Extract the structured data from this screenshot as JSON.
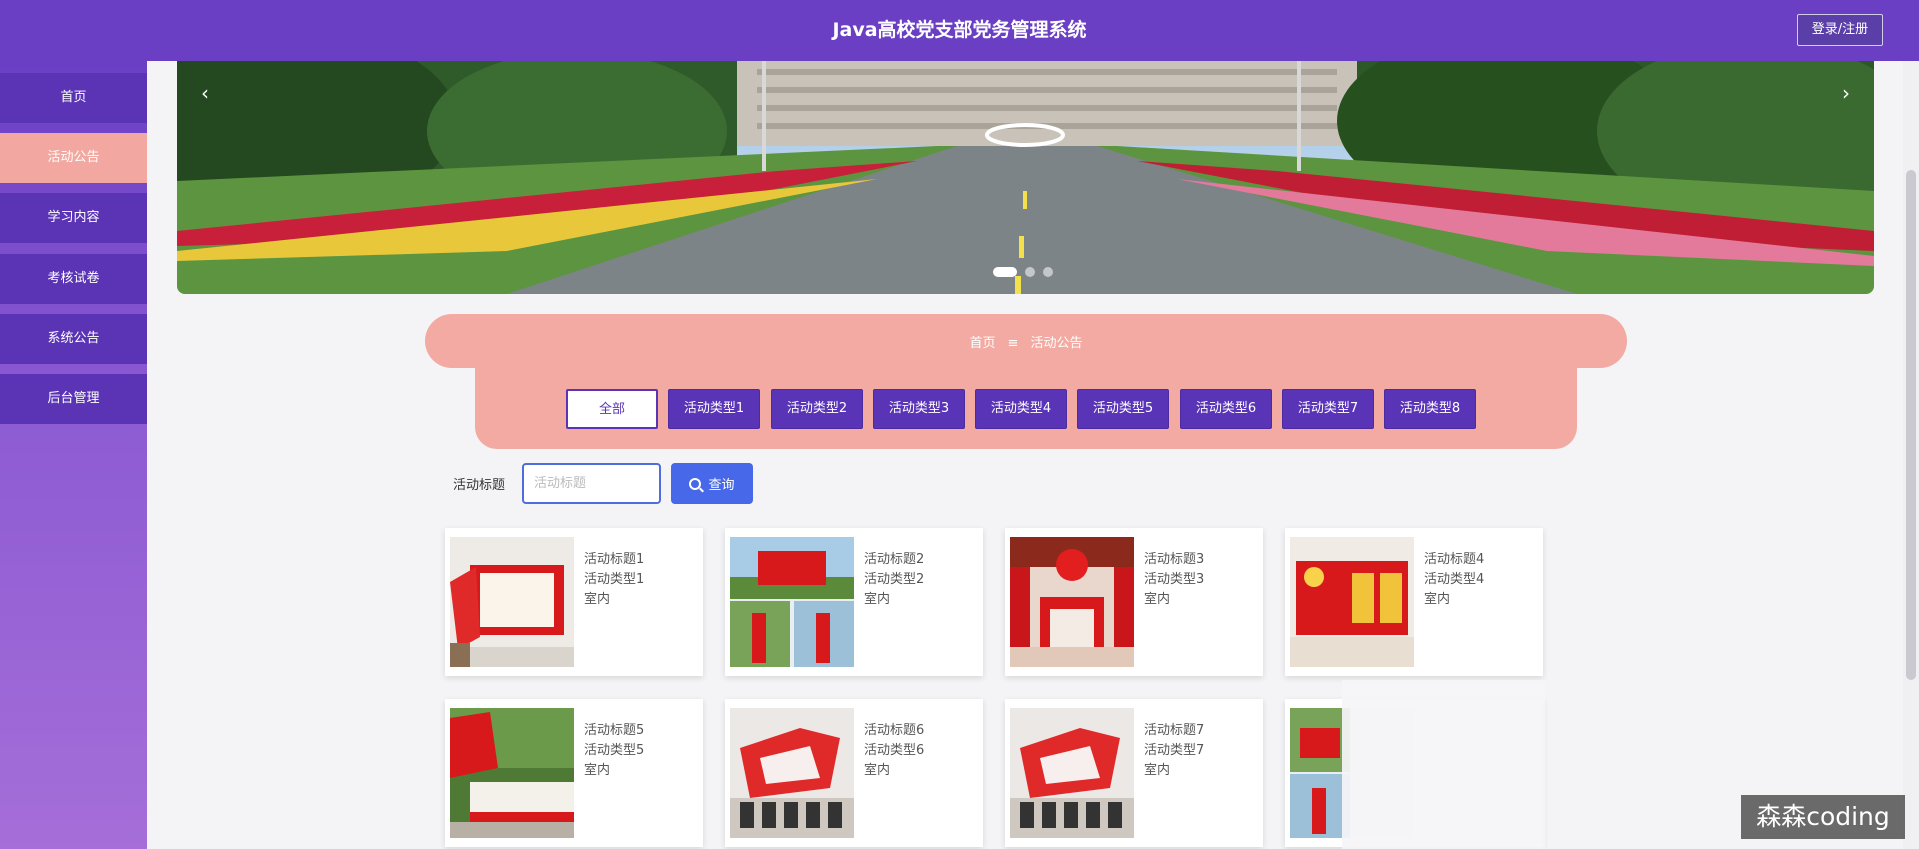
{
  "header": {
    "title": "Java高校党支部党务管理系统",
    "login_label": "登录/注册"
  },
  "sidebar": {
    "items": [
      {
        "label": "首页",
        "active": false
      },
      {
        "label": "活动公告",
        "active": true
      },
      {
        "label": "学习内容",
        "active": false
      },
      {
        "label": "考核试卷",
        "active": false
      },
      {
        "label": "系统公告",
        "active": false
      },
      {
        "label": "后台管理",
        "active": false
      }
    ]
  },
  "banner": {
    "prev_icon": "‹",
    "next_icon": "›",
    "slide_count": 3,
    "active_slide": 1
  },
  "breadcrumb": {
    "home": "首页",
    "separator": "≡",
    "current": "活动公告"
  },
  "tabs": [
    "全部",
    "活动类型1",
    "活动类型2",
    "活动类型3",
    "活动类型4",
    "活动类型5",
    "活动类型6",
    "活动类型7",
    "活动类型8"
  ],
  "active_tab": 0,
  "search": {
    "label": "活动标题",
    "placeholder": "活动标题",
    "value": "",
    "button_label": "查询",
    "icon": "search-icon"
  },
  "cards": [
    {
      "title": "活动标题1",
      "type": "活动类型1",
      "place": "室内"
    },
    {
      "title": "活动标题2",
      "type": "活动类型2",
      "place": "室内"
    },
    {
      "title": "活动标题3",
      "type": "活动类型3",
      "place": "室内"
    },
    {
      "title": "活动标题4",
      "type": "活动类型4",
      "place": "室内"
    },
    {
      "title": "活动标题5",
      "type": "活动类型5",
      "place": "室内"
    },
    {
      "title": "活动标题6",
      "type": "活动类型6",
      "place": "室内"
    },
    {
      "title": "活动标题7",
      "type": "活动类型7",
      "place": "室内"
    },
    {
      "title": "",
      "type": "",
      "place": ""
    }
  ],
  "watermark": "森森coding",
  "colors": {
    "primary": "#6a3fc4",
    "accent_pink": "#f2aaa2",
    "button_blue": "#4768e8",
    "party_red": "#d8191c"
  }
}
